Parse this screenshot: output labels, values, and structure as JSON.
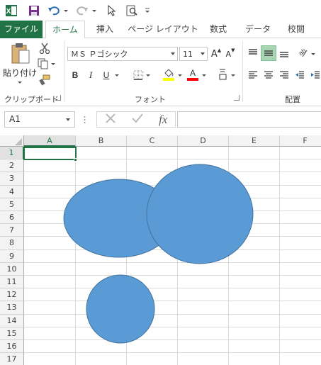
{
  "qat": {
    "excel_logo": "X",
    "icons": [
      "excel-logo-icon",
      "save-icon",
      "undo-icon",
      "redo-icon",
      "pointer-icon",
      "print-preview-icon",
      "customize-icon"
    ]
  },
  "tabs": [
    {
      "label": "ファイル"
    },
    {
      "label": "ホーム"
    },
    {
      "label": "挿入"
    },
    {
      "label": "ページ レイアウト"
    },
    {
      "label": "数式"
    },
    {
      "label": "データ"
    },
    {
      "label": "校閲"
    }
  ],
  "ribbon": {
    "clipboard": {
      "paste_label": "貼り付け",
      "group_label": "クリップボード"
    },
    "font": {
      "font_name": "ＭＳ Ｐゴシック",
      "font_size": "11",
      "bold": "B",
      "italic": "I",
      "underline": "U",
      "grow": "A",
      "shrink": "A",
      "group_label": "フォント",
      "fill_color": "#ffff00",
      "font_color": "#ff0000"
    },
    "alignment": {
      "group_label": "配置"
    }
  },
  "formula_bar": {
    "name_box": "A1",
    "fx": "fx",
    "formula": ""
  },
  "sheet": {
    "columns": [
      "A",
      "B",
      "C",
      "D",
      "E",
      "F"
    ],
    "rows": [
      "1",
      "2",
      "3",
      "4",
      "5",
      "6",
      "7",
      "8",
      "9",
      "10",
      "11",
      "12",
      "13",
      "14",
      "15",
      "16",
      "17"
    ],
    "selected_cell": "A1",
    "shape_color": "#5b9bd5",
    "shape_border": "#41719c",
    "shapes": [
      "ellipse-1",
      "circle-2",
      "circle-3"
    ]
  }
}
